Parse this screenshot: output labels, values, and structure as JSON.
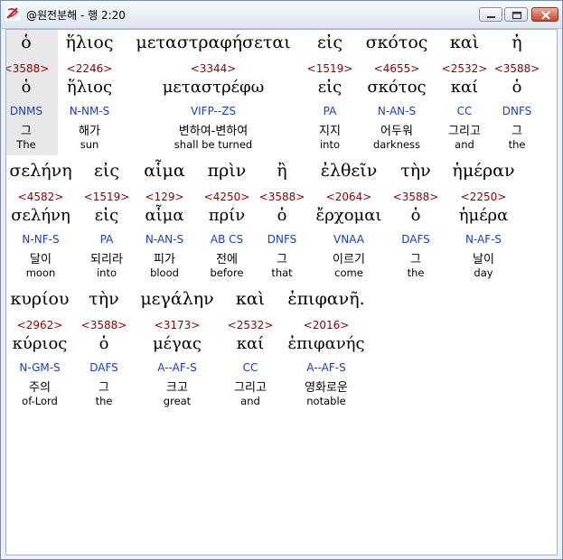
{
  "window": {
    "title": "@원전분해 - 행 2:20"
  },
  "rows": [
    [
      {
        "greek": "ὁ",
        "strong": "<3588>",
        "lemma": "ὁ",
        "morph": "DNMS",
        "kor": "그",
        "eng": "The"
      },
      {
        "greek": "ἥλιος",
        "strong": "<2246>",
        "lemma": "ἥλιος",
        "morph": "N-NM-S",
        "kor": "해가",
        "eng": "sun"
      },
      {
        "greek": "μεταστραφήσεται",
        "strong": "<3344>",
        "lemma": "μεταστρέφω",
        "morph": "VIFP--ZS",
        "kor": "변하여-변하여",
        "eng": "shall be turned"
      },
      {
        "greek": "εἰς",
        "strong": "<1519>",
        "lemma": "εἰς",
        "morph": "PA",
        "kor": "지지",
        "eng": "into"
      },
      {
        "greek": "σκότος",
        "strong": "<4655>",
        "lemma": "σκότος",
        "morph": "N-AN-S",
        "kor": "어두워",
        "eng": "darkness"
      },
      {
        "greek": "καὶ",
        "strong": "<2532>",
        "lemma": "καί",
        "morph": "CC",
        "kor": "그리고",
        "eng": "and"
      },
      {
        "greek": "ἡ",
        "strong": "<3588>",
        "lemma": "ὁ",
        "morph": "DNFS",
        "kor": "그",
        "eng": "the"
      }
    ],
    [
      {
        "greek": "σελήνη",
        "strong": "<4582>",
        "lemma": "σελήνη",
        "morph": "N-NF-S",
        "kor": "달이",
        "eng": "moon"
      },
      {
        "greek": "εἰς",
        "strong": "<1519>",
        "lemma": "εἰς",
        "morph": "PA",
        "kor": "되리라",
        "eng": "into"
      },
      {
        "greek": "αἷμα",
        "strong": "<129>",
        "lemma": "αἷμα",
        "morph": "N-AN-S",
        "kor": "피가",
        "eng": "blood"
      },
      {
        "greek": "πρὶν",
        "strong": "<4250>",
        "lemma": "πρίν",
        "morph": "AB CS",
        "kor": "전에",
        "eng": "before"
      },
      {
        "greek": "ἢ",
        "strong": "<3588>",
        "lemma": "ὁ",
        "morph": "DNFS",
        "kor": "그",
        "eng": "that"
      },
      {
        "greek": "ἐλθεῖν",
        "strong": "<2064>",
        "lemma": "ἔρχομαι",
        "morph": "VNAA",
        "kor": "이르기",
        "eng": "come"
      },
      {
        "greek": "τὴν",
        "strong": "<3588>",
        "lemma": "ὁ",
        "morph": "DAFS",
        "kor": "그",
        "eng": "the"
      },
      {
        "greek": "ἡμέραν",
        "strong": "<2250>",
        "lemma": "ἡμέρα",
        "morph": "N-AF-S",
        "kor": "날이",
        "eng": "day"
      }
    ],
    [
      {
        "greek": "κυρίου",
        "strong": "<2962>",
        "lemma": "κύριος",
        "morph": "N-GM-S",
        "kor": "주의",
        "eng": "of-Lord"
      },
      {
        "greek": "τὴν",
        "strong": "<3588>",
        "lemma": "ὁ",
        "morph": "DAFS",
        "kor": "그",
        "eng": "the"
      },
      {
        "greek": "μεγάλην",
        "strong": "<3173>",
        "lemma": "μέγας",
        "morph": "A--AF-S",
        "kor": "크고",
        "eng": "great"
      },
      {
        "greek": "καὶ",
        "strong": "<2532>",
        "lemma": "καί",
        "morph": "CC",
        "kor": "그리고",
        "eng": "and"
      },
      {
        "greek": "ἐπιφανῆ.",
        "strong": "<2016>",
        "lemma": "ἐπιφανής",
        "morph": "A--AF-S",
        "kor": "영화로운",
        "eng": "notable"
      }
    ]
  ]
}
